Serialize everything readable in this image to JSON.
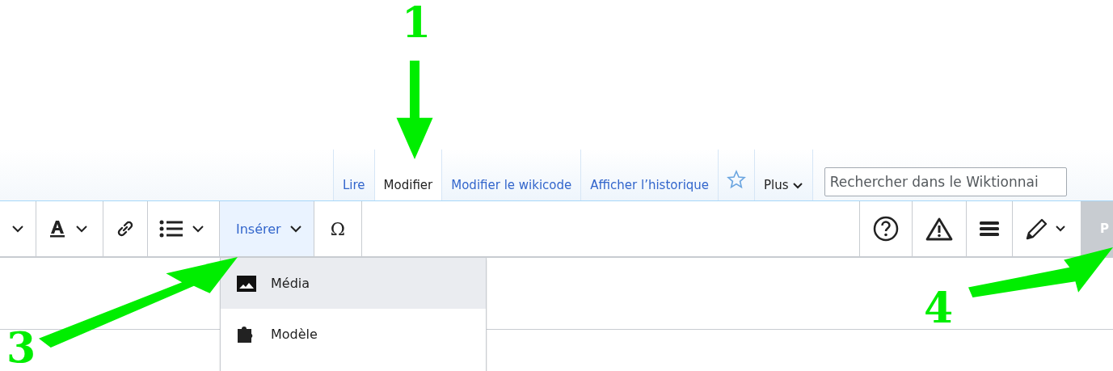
{
  "tabs": [
    {
      "label": "Lire",
      "selected": false
    },
    {
      "label": "Modifier",
      "selected": true
    },
    {
      "label": "Modifier le wikicode",
      "selected": false
    },
    {
      "label": "Afficher l’historique",
      "selected": false
    }
  ],
  "more_menu": {
    "label": "Plus"
  },
  "search": {
    "placeholder": "Rechercher dans le Wiktionnai"
  },
  "toolbar_left": [
    {
      "kind": "chevron"
    },
    {
      "kind": "text-style"
    },
    {
      "kind": "link"
    },
    {
      "kind": "list"
    }
  ],
  "insert_menu": {
    "label": "Insérer",
    "expanded": true,
    "items": [
      {
        "label": "Média",
        "kind": "media",
        "selected": true
      },
      {
        "label": "Modèle",
        "kind": "template",
        "selected": false
      }
    ]
  },
  "special_char": {
    "label": "Ω"
  },
  "toolbar_right": [
    {
      "kind": "help"
    },
    {
      "kind": "warning"
    },
    {
      "kind": "page-options"
    },
    {
      "kind": "edit-mode"
    }
  ],
  "publish_button": {
    "label": "P"
  },
  "annotations": [
    {
      "label": "1",
      "kind": "down"
    },
    {
      "label": "3",
      "kind": "up-right"
    },
    {
      "label": "4",
      "kind": "right"
    }
  ]
}
